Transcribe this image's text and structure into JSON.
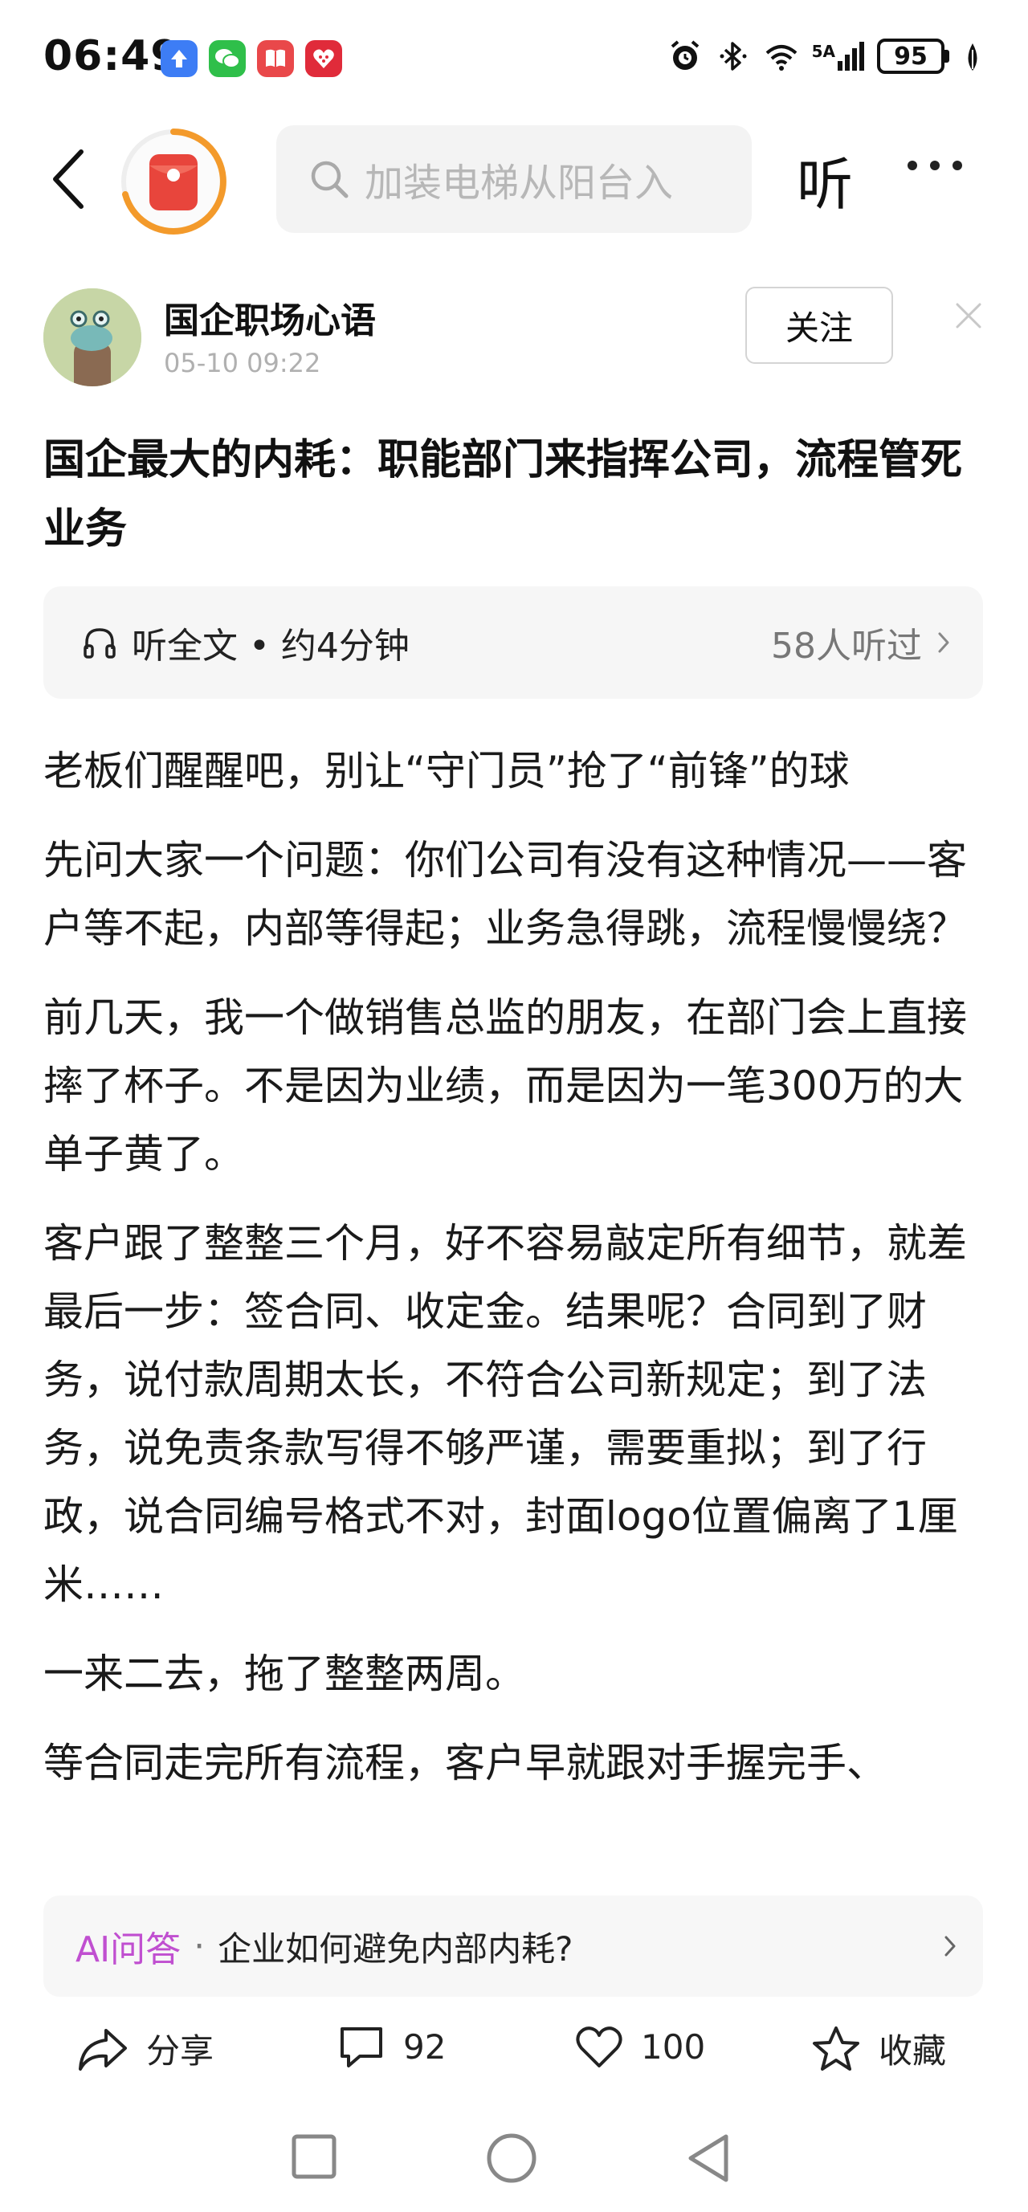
{
  "status_bar": {
    "time": "06:49",
    "network": "5A",
    "battery": "95",
    "app_icons": [
      "upload-icon",
      "wechat-icon",
      "book-icon",
      "gift-icon"
    ]
  },
  "header": {
    "search_placeholder": "加装电梯从阳台入",
    "listen_label": "听"
  },
  "author": {
    "name": "国企职场心语",
    "time": "05-10 09:22",
    "follow_label": "关注"
  },
  "article": {
    "title": "国企最大的内耗：职能部门来指挥公司，流程管死业务",
    "listen_bar": {
      "label": "听全文 • 约4分钟",
      "listeners": "58人听过"
    },
    "paragraphs": [
      "老板们醒醒吧，别让“守门员”抢了“前锋”的球",
      "先问大家一个问题：你们公司有没有这种情况——客户等不起，内部等得起；业务急得跳，流程慢慢绕？",
      "前几天，我一个做销售总监的朋友，在部门会上直接摔了杯子。不是因为业绩，而是因为一笔300万的大单子黄了。",
      "客户跟了整整三个月，好不容易敲定所有细节，就差最后一步：签合同、收定金。结果呢？合同到了财务，说付款周期太长，不符合公司新规定；到了法务，说免责条款写得不够严谨，需要重拟；到了行政，说合同编号格式不对，封面logo位置偏离了1厘米……",
      "一来二去，拖了整整两周。",
      "等合同走完所有流程，客户早就跟对手握完手、"
    ]
  },
  "ai_qa": {
    "label": "AI问答",
    "separator": "·",
    "question": "企业如何避免内部内耗?"
  },
  "actions": {
    "share": "分享",
    "comments": "92",
    "likes": "100",
    "favorite": "收藏"
  },
  "colors": {
    "ai_accent": "#c04fd0",
    "logo_red": "#e8453c",
    "logo_ring": "#f39a2b"
  }
}
